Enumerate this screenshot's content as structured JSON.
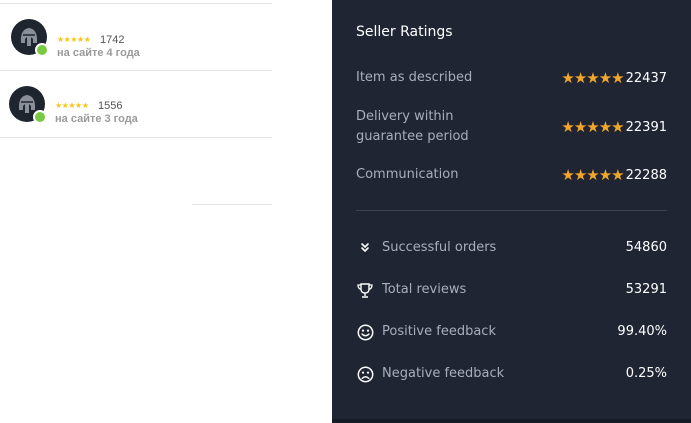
{
  "sellers": [
    {
      "stars": "★★★★★",
      "count": "1742",
      "since": "на сайте 4 года"
    },
    {
      "stars": "★★★★★",
      "count": "1556",
      "since": "на сайте 3 года"
    }
  ],
  "ratings_panel": {
    "title": "Seller Ratings",
    "ratings": [
      {
        "label_line1": "Item as described",
        "label_line2": "",
        "stars": "★★★★★",
        "count": "22437"
      },
      {
        "label_line1": "Delivery within",
        "label_line2": "guarantee period",
        "stars": "★★★★★",
        "count": "22391"
      },
      {
        "label_line1": "Communication",
        "label_line2": "",
        "stars": "★★★★★",
        "count": "22288"
      }
    ],
    "stats": [
      {
        "icon": "double-chevron-down-icon",
        "label": "Successful orders",
        "value": "54860"
      },
      {
        "icon": "trophy-icon",
        "label": "Total reviews",
        "value": "53291"
      },
      {
        "icon": "smile-icon",
        "label": "Positive feedback",
        "value": "99.40%"
      },
      {
        "icon": "frown-icon",
        "label": "Negative feedback",
        "value": "0.25%"
      }
    ]
  },
  "colors": {
    "panel_bg": "#1f2533",
    "star_gold": "#f4a62a",
    "mini_star": "#f5c518",
    "online_green": "#7ac943"
  }
}
